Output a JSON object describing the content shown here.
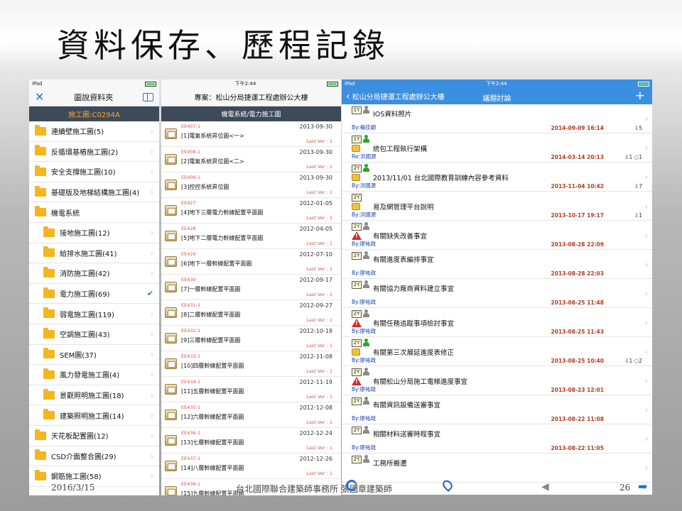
{
  "slide": {
    "title": "資料保存、歷程記錄",
    "footer_date": "2016/3/15",
    "footer_center": "台北國際聯合建築師事務所 張國章建築師",
    "page_number": "26"
  },
  "screen1": {
    "status_left": "iPad",
    "nav_title": "圖說資料夾",
    "close_icon": "✕",
    "subbar": "施工圖:C0294A",
    "folders": [
      {
        "label": "連續壁施工圖(5)",
        "indent": false,
        "mark": "chevron"
      },
      {
        "label": "反循環基樁施工圖(2)",
        "indent": false,
        "mark": "chevron"
      },
      {
        "label": "安全支撐施工圖(10)",
        "indent": false,
        "mark": "chevron"
      },
      {
        "label": "基礎版及地梯結構施工圖(4)",
        "indent": false,
        "mark": "chevron"
      },
      {
        "label": "機電系統",
        "indent": false,
        "mark": "none"
      },
      {
        "label": "接地施工圖(12)",
        "indent": true,
        "mark": "chevron"
      },
      {
        "label": "給排水施工圖(41)",
        "indent": true,
        "mark": "chevron"
      },
      {
        "label": "消防施工圖(42)",
        "indent": true,
        "mark": "chevron"
      },
      {
        "label": "電力施工圖(69)",
        "indent": true,
        "mark": "check"
      },
      {
        "label": "弱電施工圖(119)",
        "indent": true,
        "mark": "chevron"
      },
      {
        "label": "空調施工圖(43)",
        "indent": true,
        "mark": "chevron"
      },
      {
        "label": "SEM圖(37)",
        "indent": true,
        "mark": "chevron"
      },
      {
        "label": "風力發電施工圖(4)",
        "indent": true,
        "mark": "chevron"
      },
      {
        "label": "景觀照明施工圖(18)",
        "indent": true,
        "mark": "chevron"
      },
      {
        "label": "建築照明施工圖(14)",
        "indent": true,
        "mark": "chevron"
      },
      {
        "label": "天花板配置圖(12)",
        "indent": false,
        "mark": "chevron"
      },
      {
        "label": "CSD介面整合圖(29)",
        "indent": false,
        "mark": "chevron"
      },
      {
        "label": "鋼筋施工圖(58)",
        "indent": false,
        "mark": "chevron"
      }
    ]
  },
  "screen2": {
    "status_time": "下午2:44",
    "nav_title": "專案：松山分局捷運工程處辦公大樓",
    "subbar": "機電系統/電力施工圖",
    "version_label": "Last Ver : 1",
    "drawings": [
      {
        "code": "EE407-1",
        "name": "[1]電氣系統昇位圖<一>",
        "date": "2013-09-30"
      },
      {
        "code": "EE408-1",
        "name": "[2]電氣系統昇位圖<二>",
        "date": "2013-09-30"
      },
      {
        "code": "EE409-1",
        "name": "[3]控控系統昇位圖",
        "date": "2013-09-30"
      },
      {
        "code": "EE427",
        "name": "[4]地下三層電力幹線配置平面圖",
        "date": "2012-01-05"
      },
      {
        "code": "EE428",
        "name": "[5]地下二層電力幹線配置平面圖",
        "date": "2012-04-05"
      },
      {
        "code": "EE429",
        "name": "[6]地下一層幹線配置平面圖",
        "date": "2012-07-10"
      },
      {
        "code": "EE430",
        "name": "[7]一層幹線配置平面圖",
        "date": "2012-09-17"
      },
      {
        "code": "EE431-1",
        "name": "[8]二層幹線配置平面圖",
        "date": "2012-09-27"
      },
      {
        "code": "EE432-1",
        "name": "[9]三層幹線配置平面圖",
        "date": "2012-10-18"
      },
      {
        "code": "EE433-1",
        "name": "[10]四層幹線配置平面圖",
        "date": "2012-11-08"
      },
      {
        "code": "EE434-1",
        "name": "[11]五層幹線配置平面圖",
        "date": "2012-11-19"
      },
      {
        "code": "EE435-1",
        "name": "[12]六層幹線配置平面圖",
        "date": "2012-12-08"
      },
      {
        "code": "EE436-1",
        "name": "[13]七層幹線配置平面圖",
        "date": "2012-12-24"
      },
      {
        "code": "EE437-1",
        "name": "[14]八層幹線配置平面圖",
        "date": "2012-12-26"
      },
      {
        "code": "EE438-1",
        "name": "[15]九層幹線配置平面圖",
        "date": ""
      }
    ]
  },
  "screen3": {
    "status_left": "iPad",
    "status_time": "下午2:44",
    "back_label": "松山分局捷運工程處辦公大樓",
    "nav_title": "議題討論",
    "plus_label": "+",
    "colors": {
      "green": "#2aa52a",
      "gray": "#8a8a8a",
      "date": "#b33a1f"
    },
    "topics": [
      {
        "tag": "1Y",
        "person": "gray",
        "icon": "none",
        "title": "IOS資料照片",
        "by": "By:楊佳穎",
        "date": "2014-09-09 16:14",
        "stats": "⇩5"
      },
      {
        "tag": "1Y",
        "person": "green",
        "icon": "folder",
        "title": "統包工程執行架構",
        "by": "Re:洪國源",
        "date": "2014-03-14 20:13",
        "stats": "⇩1 ○1"
      },
      {
        "tag": "2Y",
        "person": "green",
        "icon": "folder",
        "title": "2013/11/01 台北國際教育訓練內容參考資料",
        "by": "By:洪國源",
        "date": "2013-11-04 10:42",
        "stats": "⇩7"
      },
      {
        "tag": "2Y",
        "person": "none",
        "icon": "folder",
        "title": "易及網管理平台說明",
        "by": "By:洪國源",
        "date": "2013-10-17 19:17",
        "stats": "⇩1"
      },
      {
        "tag": "2Y",
        "person": "gray",
        "icon": "warn",
        "title": "有關缺失改善事宜",
        "by": "By:廖祐政",
        "date": "2013-08-28 22:09",
        "stats": ""
      },
      {
        "tag": "2Y",
        "person": "gray",
        "icon": "none",
        "title": "有關進度表編排事宜",
        "by": "By:廖祐政",
        "date": "2013-08-28 22:03",
        "stats": ""
      },
      {
        "tag": "2Y",
        "person": "gray",
        "icon": "none",
        "title": "有關協力廠商資料建立事宜",
        "by": "By:廖祐政",
        "date": "2013-08-25 11:48",
        "stats": ""
      },
      {
        "tag": "2Y",
        "person": "gray",
        "icon": "warn",
        "title": "有關任務追蹤事項檢討事宜",
        "by": "By:廖祐政",
        "date": "2013-08-25 11:43",
        "stats": ""
      },
      {
        "tag": "2Y",
        "person": "green",
        "icon": "folder",
        "title": "有關第三次展延進度表修正",
        "by": "By:廖祐政",
        "date": "2013-08-25 10:40",
        "stats": "⇩1 ○2"
      },
      {
        "tag": "2Y",
        "person": "gray",
        "icon": "warn",
        "title": "有關松山分局施工電梯進度事宜",
        "by": "By:廖祐政",
        "date": "2013-08-23 12:01",
        "stats": ""
      },
      {
        "tag": "2Y",
        "person": "gray",
        "icon": "none",
        "title": "有關資訊設備送審事宜",
        "by": "By:廖祐政",
        "date": "2013-08-22 11:08",
        "stats": ""
      },
      {
        "tag": "2Y",
        "person": "gray",
        "icon": "none",
        "title": "相關材料送審時程事宜",
        "by": "By:廖祐政",
        "date": "2013-08-22 11:05",
        "stats": ""
      },
      {
        "tag": "2Y",
        "person": "gray",
        "icon": "none",
        "title": "工務所搬遷",
        "by": "",
        "date": "",
        "stats": ""
      }
    ]
  }
}
